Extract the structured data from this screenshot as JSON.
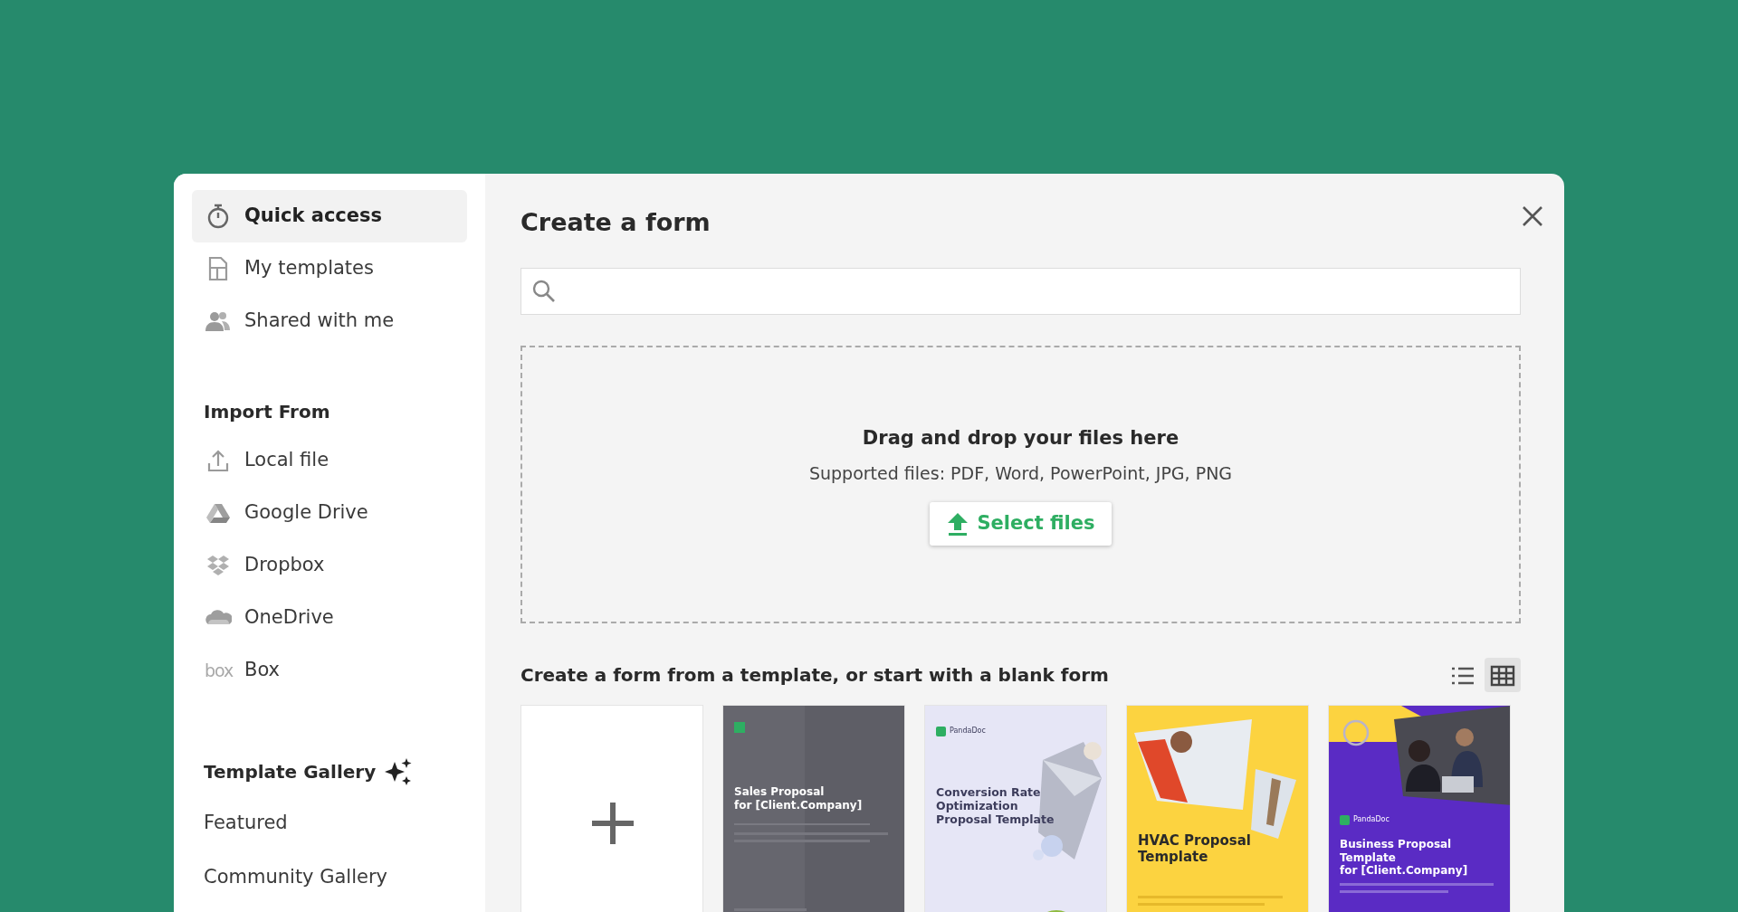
{
  "sidebar": {
    "nav": [
      {
        "label": "Quick access",
        "selected": true
      },
      {
        "label": "My templates",
        "selected": false
      },
      {
        "label": "Shared with me",
        "selected": false
      }
    ],
    "import": {
      "heading": "Import From",
      "items": [
        {
          "label": "Local file"
        },
        {
          "label": "Google Drive"
        },
        {
          "label": "Dropbox"
        },
        {
          "label": "OneDrive"
        },
        {
          "label": "Box",
          "logo_text": "box"
        }
      ]
    },
    "gallery": {
      "heading": "Template Gallery",
      "items": [
        "Featured",
        "Community Gallery"
      ]
    }
  },
  "main": {
    "title": "Create a form",
    "dropzone": {
      "heading": "Drag and drop your files here",
      "hint": "Supported files: PDF, Word, PowerPoint, JPG, PNG",
      "button": "Select files"
    },
    "templates": {
      "heading": "Create a form from a template, or start with a blank form",
      "view_modes": [
        {
          "selected": false
        },
        {
          "selected": true
        }
      ],
      "cards": [
        {
          "kind": "blank"
        },
        {
          "kind": "document",
          "title_lines": [
            "Sales Proposal",
            "for [Client.Company]"
          ]
        },
        {
          "kind": "document",
          "brand": "PandaDoc",
          "title_lines": [
            "Conversion Rate",
            "Optimization",
            "Proposal Template"
          ]
        },
        {
          "kind": "document",
          "title_lines": [
            "HVAC Proposal",
            "Template"
          ]
        },
        {
          "kind": "document",
          "brand": "PandaDoc",
          "title_lines": [
            "Business Proposal Template",
            "for [Client.Company]"
          ]
        }
      ]
    }
  }
}
